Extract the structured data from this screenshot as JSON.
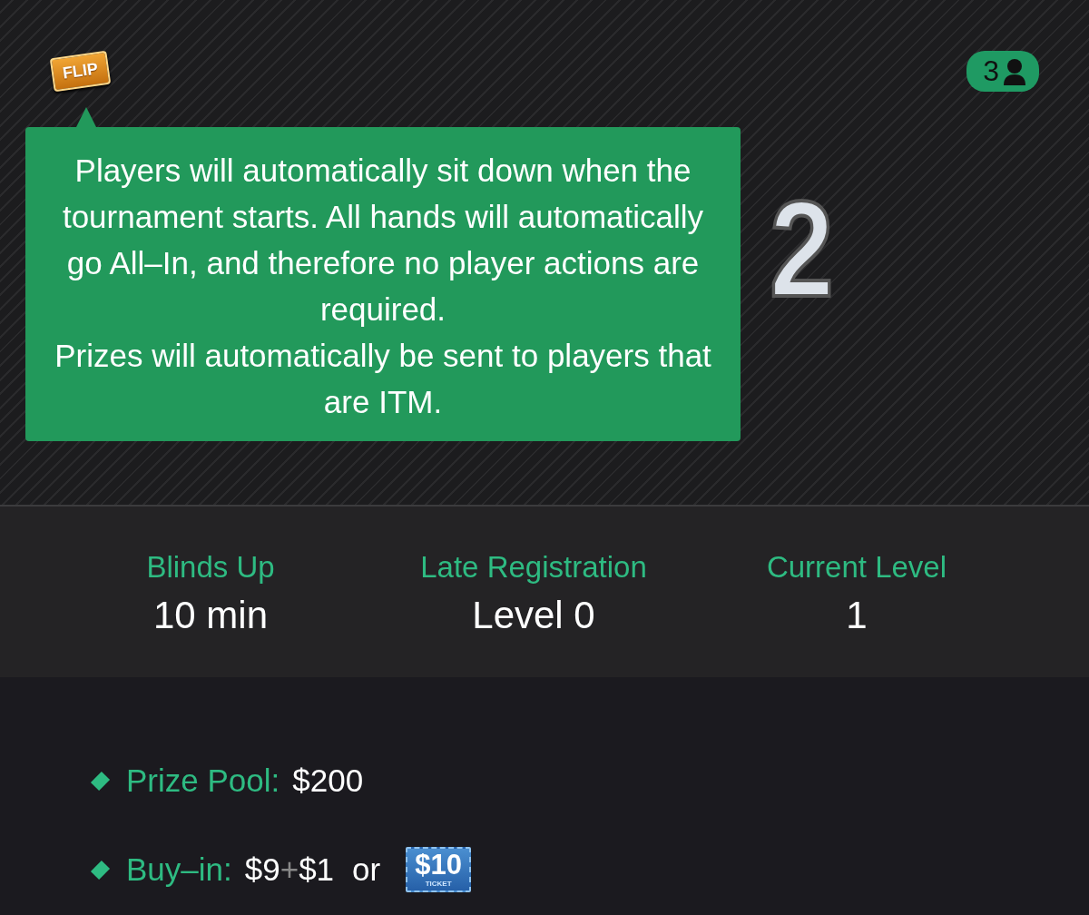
{
  "header": {
    "badge": "FLIP",
    "big_number": "2",
    "players": "3"
  },
  "tooltip": {
    "lines": [
      "Players will automatically sit down when the tournament starts. All hands will automatically go All–In, and therefore no player actions are required.",
      "Prizes will automatically be sent to players that are ITM."
    ]
  },
  "stats": [
    {
      "label": "Blinds Up",
      "value": "10 min"
    },
    {
      "label": "Late Registration",
      "value": "Level 0"
    },
    {
      "label": "Current Level",
      "value": "1"
    }
  ],
  "info": [
    {
      "kind": "prize",
      "label": "Prize Pool:",
      "value": "$200"
    },
    {
      "kind": "buyin",
      "label": "Buy–in:",
      "value": "$9",
      "fee": "$1",
      "plus": "+",
      "or": "or",
      "ticket": {
        "amount": "$10",
        "caption": "TICKET"
      }
    }
  ]
}
